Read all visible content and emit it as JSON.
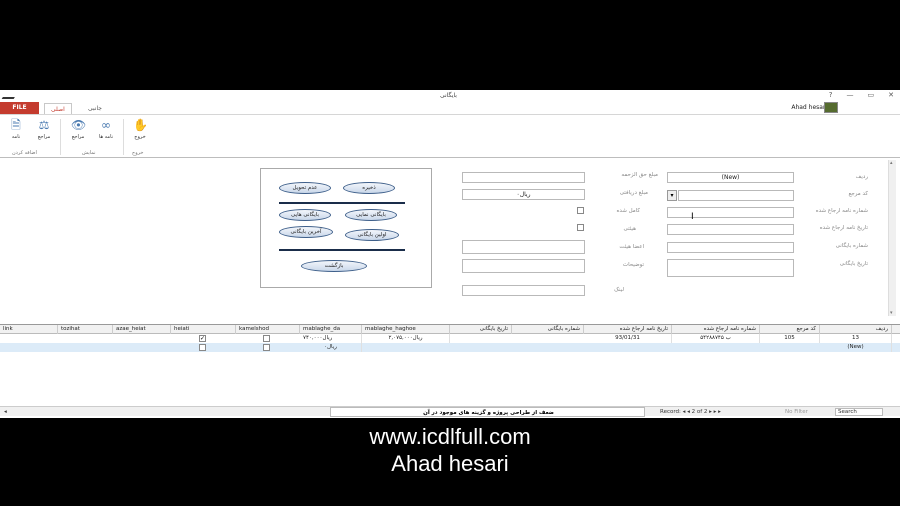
{
  "window": {
    "title": "بایگانی",
    "help": "?",
    "minimize": "—",
    "restore": "▭",
    "close": "✕"
  },
  "tabs": {
    "file": "FILE",
    "home": "اصلی",
    "other": "جانبی"
  },
  "user": {
    "name": "Ahad hesari ▾"
  },
  "ribbon": {
    "btn_name": "نامه",
    "btn_marjae": "مراجع",
    "btn_marjae2": "مراجع",
    "btn_names": "نامه ها",
    "btn_exit": "خروج",
    "group_add": "اضافه کردن",
    "group_show": "نمایش",
    "group_exit": "خروج"
  },
  "nav_panel": {
    "defect": "عدم تحویل",
    "save": "ذخیره",
    "archive_edit": "بایگانی هایی",
    "archive_show": "بایگانی نمایی",
    "latest_archive": "آخرین بایگانی",
    "first_archive": "اولین بایگانی",
    "back": "بازگشت"
  },
  "form": {
    "radif_label": "ردیف",
    "radif_value": "(New)",
    "code_label": "کد مرجع",
    "letter_no_label": "شماره نامه ارجاع شده",
    "letter_date_label": "تاریخ نامه ارجاع شده",
    "archive_no_label": "شماره بایگانی",
    "archive_date_label": "تاریخ بایگانی",
    "amount_label": "مبلغ حق الزحمه",
    "received_label": "مبلغ دریافتی",
    "received_value": "ریال۰",
    "complete_label": "کامل شده",
    "board_label": "هیئتی",
    "members_label": "اعضا هیئت",
    "notes_label": "توضیحات",
    "link_label": "لینک",
    "dropdown": "▾"
  },
  "grid": {
    "headers": [
      "link",
      "tozihat",
      "azae_heiat",
      "heiati",
      "kamelshod",
      "mablaghe_da",
      "mablaghe_haghoe",
      "تاریخ بایگانی",
      "شماره بایگانی",
      "تاریخ نامه ارجاع شده",
      "شماره نامه ارجاع شده",
      "کد مرجع",
      "ردیف"
    ],
    "row1": {
      "mablaghe_da": "ریال۷۴۰,۰۰۰",
      "mablaghe_haghoe": "ریال۲,۰۷۵,۰۰۰",
      "letter_date": "93/01/31",
      "letter_no": "۵۴۲۸۸۷۴۵ ب",
      "code": "105",
      "radif": "13",
      "heiati_checked": "✓"
    },
    "row_new": {
      "mablaghe_da": "ریال۰",
      "radif": "(New)"
    }
  },
  "status": {
    "message": "ضعف از طراحی پروژه و گزینه های موجود در آن",
    "record": "Record: ◂ ◂ 2 of 2 ▸ ▸ ▸",
    "nofilter": "No Filter",
    "search": "Search"
  },
  "watermark": {
    "site": "www.icdlfull.com",
    "author": "Ahad hesari"
  }
}
